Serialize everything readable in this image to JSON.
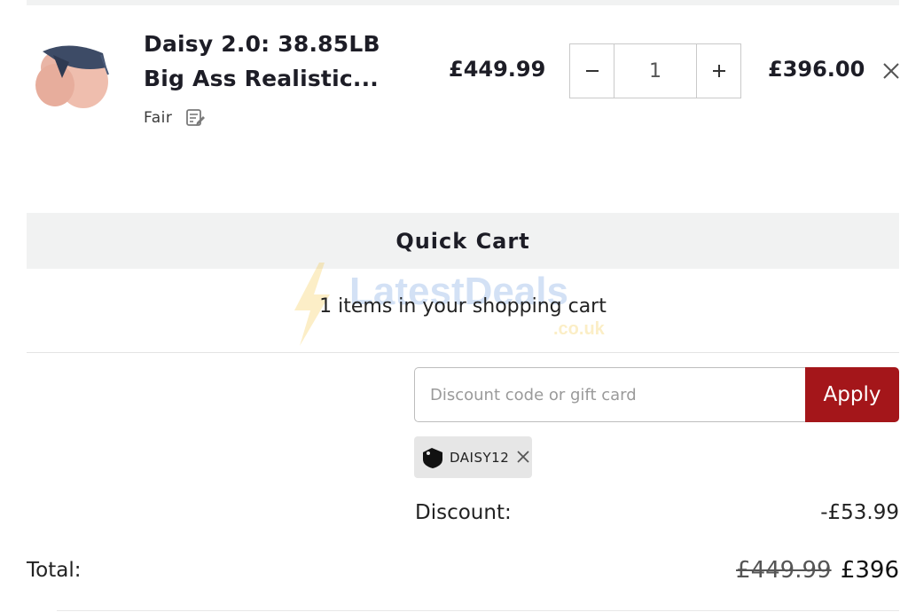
{
  "product": {
    "name": "Daisy 2.0: 38.85LB Big Ass Realistic...",
    "variant": "Fair",
    "unit_price": "£449.99",
    "quantity": "1",
    "line_total": "£396.00",
    "icons": {
      "edit": "edit-note-icon",
      "remove": "close-icon",
      "decrease": "minus-icon",
      "increase": "plus-icon"
    }
  },
  "quick_cart": {
    "title": "Quick Cart",
    "items_count": "1 items in your shopping cart"
  },
  "watermark": {
    "text": "LatestDeals",
    "suffix": ".co.uk"
  },
  "discount": {
    "placeholder": "Discount code or gift card",
    "apply_label": "Apply",
    "applied_code": "DAISY12",
    "label": "Discount:",
    "value": "-£53.99"
  },
  "total": {
    "label": "Total:",
    "original": "£449.99",
    "final": "£396"
  },
  "colors": {
    "apply_button": "#a4161a",
    "bar_background": "#f1f2f2",
    "chip_background": "#e6e6e6"
  }
}
